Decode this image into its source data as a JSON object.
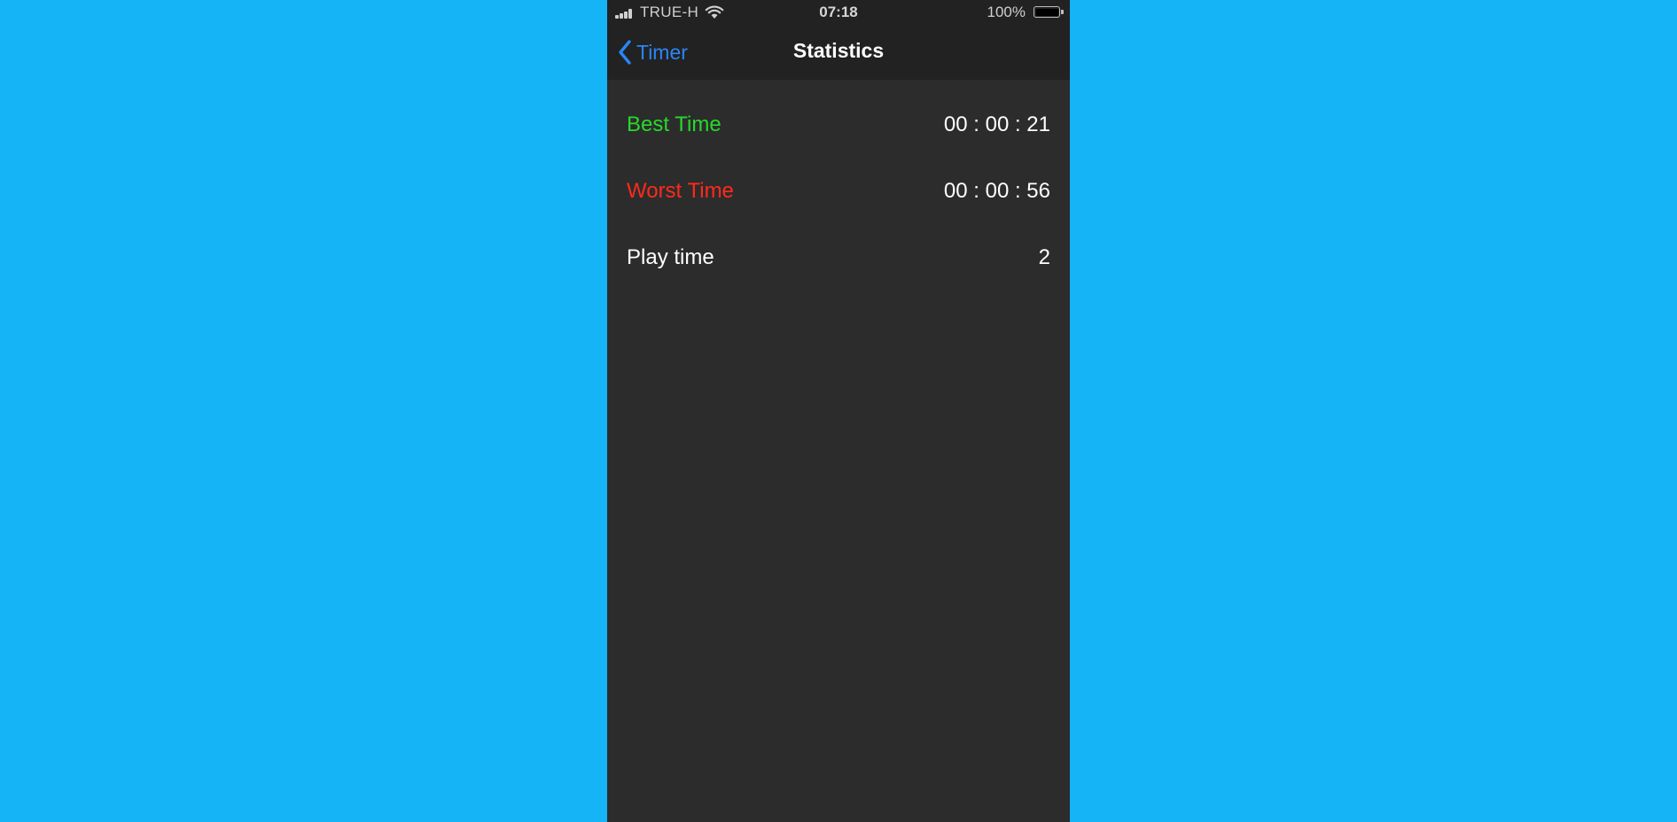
{
  "status_bar": {
    "carrier": "TRUE-H",
    "time": "07:18",
    "battery": "100%"
  },
  "nav": {
    "back_label": "Timer",
    "title": "Statistics"
  },
  "stats": [
    {
      "label": "Best Time",
      "value": "00 : 00 : 21",
      "color": "#27d92a"
    },
    {
      "label": "Worst Time",
      "value": "00 : 00 : 56",
      "color": "#ff2a1a"
    },
    {
      "label": "Play time",
      "value": "2",
      "color": "#ffffff"
    }
  ],
  "colors": {
    "background": "#14b4f6",
    "screen": "#2c2c2c",
    "bar": "#222222",
    "accent": "#2a86f5"
  }
}
